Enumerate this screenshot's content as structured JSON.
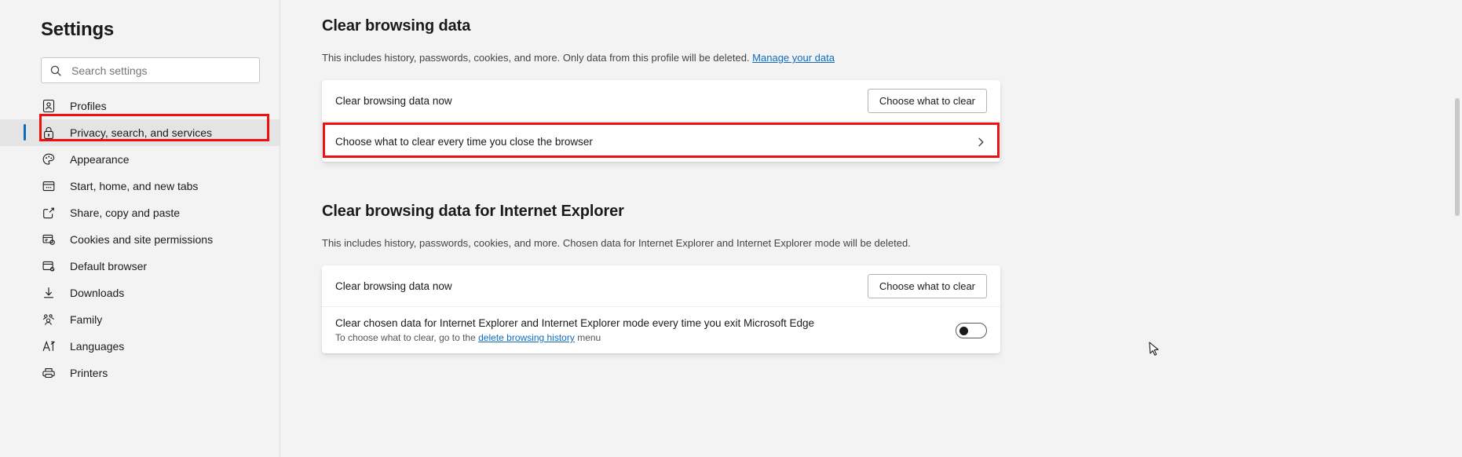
{
  "sidebar": {
    "title": "Settings",
    "search": {
      "placeholder": "Search settings",
      "value": "",
      "icon": "search-icon"
    },
    "items": [
      {
        "label": "Profiles",
        "icon": "profile-icon",
        "selected": false
      },
      {
        "label": "Privacy, search, and services",
        "icon": "lock-icon",
        "selected": true
      },
      {
        "label": "Appearance",
        "icon": "palette-icon",
        "selected": false
      },
      {
        "label": "Start, home, and new tabs",
        "icon": "window-tabs-icon",
        "selected": false
      },
      {
        "label": "Share, copy and paste",
        "icon": "share-icon",
        "selected": false
      },
      {
        "label": "Cookies and site permissions",
        "icon": "cookies-settings-icon",
        "selected": false
      },
      {
        "label": "Default browser",
        "icon": "browser-check-icon",
        "selected": false
      },
      {
        "label": "Downloads",
        "icon": "download-arrow-icon",
        "selected": false
      },
      {
        "label": "Family",
        "icon": "family-people-icon",
        "selected": false
      },
      {
        "label": "Languages",
        "icon": "language-a-icon",
        "selected": false
      },
      {
        "label": "Printers",
        "icon": "printer-icon",
        "selected": false
      }
    ]
  },
  "main": {
    "section1": {
      "title": "Clear browsing data",
      "description_before": "This includes history, passwords, cookies, and more. Only data from this profile will be deleted. ",
      "description_link": "Manage your data",
      "rows": [
        {
          "label": "Clear browsing data now",
          "button": "Choose what to clear"
        },
        {
          "label": "Choose what to clear every time you close the browser",
          "chevron": "chevron-right-icon"
        }
      ]
    },
    "section2": {
      "title": "Clear browsing data for Internet Explorer",
      "description": "This includes history, passwords, cookies, and more. Chosen data for Internet Explorer and Internet Explorer mode will be deleted.",
      "rows": [
        {
          "label": "Clear browsing data now",
          "button": "Choose what to clear"
        },
        {
          "label": "Clear chosen data for Internet Explorer and Internet Explorer mode every time you exit Microsoft Edge",
          "sub_before": "To choose what to clear, go to the ",
          "sub_link": "delete browsing history",
          "sub_after": " menu",
          "toggle_on": false
        }
      ]
    }
  },
  "highlights": {
    "color": "#ef1010",
    "targets": [
      "Privacy, search, and services",
      "Choose what to clear every time you close the browser"
    ]
  },
  "colors": {
    "accent": "#0f6cbd",
    "page_bg": "#f3f3f3",
    "card_bg": "#ffffff",
    "text": "#1a1a1a"
  }
}
